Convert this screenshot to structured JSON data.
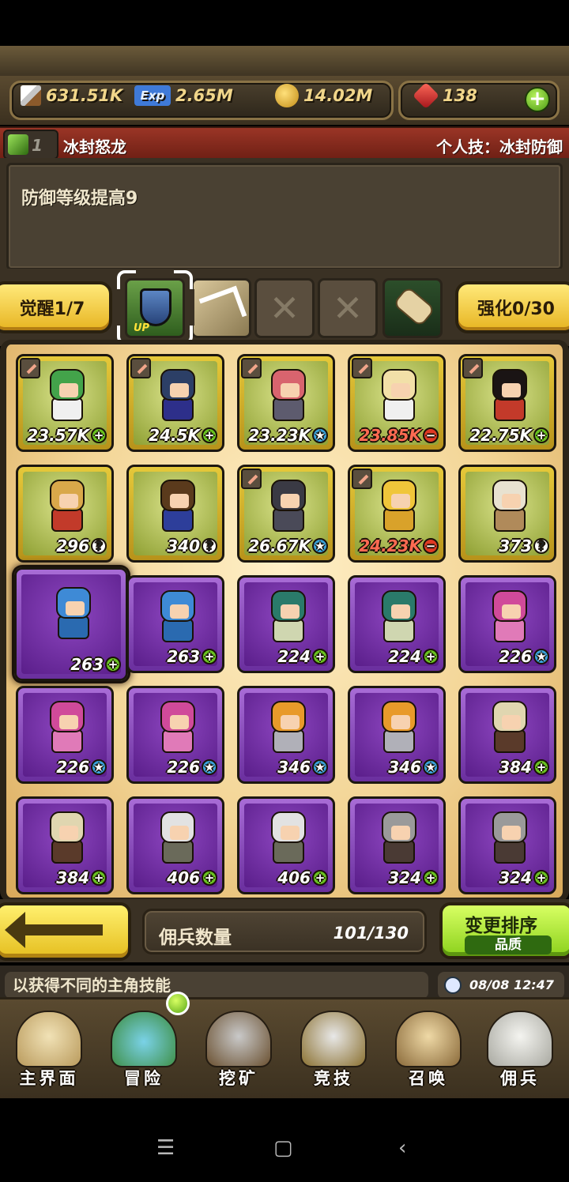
{
  "resources": {
    "attack": "631.51K",
    "exp_label": "Exp",
    "exp": "2.65M",
    "gold": "14.02M",
    "gems": "138",
    "add_label": "+"
  },
  "skill": {
    "level": "1",
    "name": "冰封怒龙",
    "personal": "个人技：冰封防御"
  },
  "description": "防御等级提高9",
  "awaken": {
    "awaken_label": "觉醒1/7",
    "enhance_label": "强化0/30",
    "slot_up": "UP",
    "slot_empty": "✕"
  },
  "roster": [
    {
      "value": "23.57K",
      "badge": "+",
      "tier": "gold",
      "weapon": true,
      "hair": "#43a34a",
      "cloth": "#f0f0f0"
    },
    {
      "value": "24.5K",
      "badge": "+",
      "tier": "gold",
      "weapon": true,
      "hair": "#2c3f66",
      "cloth": "#2d2f8a"
    },
    {
      "value": "23.23K",
      "badge": "★",
      "tier": "gold",
      "weapon": true,
      "hair": "#d8646e",
      "cloth": "#5d5b6e"
    },
    {
      "value": "23.85K",
      "badge": "−",
      "tier": "gold",
      "weapon": true,
      "hair": "#f2e0a8",
      "cloth": "#f0f0f0",
      "red": true
    },
    {
      "value": "22.75K",
      "badge": "+",
      "tier": "gold",
      "weapon": true,
      "hair": "#1a1414",
      "cloth": "#c33a2a"
    },
    {
      "value": "296",
      "badge": "?",
      "tier": "gold",
      "weapon": false,
      "hair": "#d9a84a",
      "cloth": "#c23a2a"
    },
    {
      "value": "340",
      "badge": "?",
      "tier": "gold",
      "weapon": false,
      "hair": "#5a3a1c",
      "cloth": "#2d3e9a"
    },
    {
      "value": "26.67K",
      "badge": "★",
      "tier": "gold",
      "weapon": true,
      "hair": "#3a3a44",
      "cloth": "#4a4a58"
    },
    {
      "value": "24.23K",
      "badge": "−",
      "tier": "gold",
      "weapon": true,
      "hair": "#f0c63a",
      "cloth": "#d9a22a",
      "red": true
    },
    {
      "value": "373",
      "badge": "?",
      "tier": "gold",
      "weapon": false,
      "hair": "#e8e2d0",
      "cloth": "#b08a5a"
    },
    {
      "value": "263",
      "badge": "+",
      "tier": "purple",
      "selected": true,
      "hair": "#3e8ad6",
      "cloth": "#2a6ab0"
    },
    {
      "value": "263",
      "badge": "+",
      "tier": "purple",
      "hair": "#3e8ad6",
      "cloth": "#2a6ab0"
    },
    {
      "value": "224",
      "badge": "+",
      "tier": "purple",
      "hair": "#2a7a6a",
      "cloth": "#cfd6b0"
    },
    {
      "value": "224",
      "badge": "+",
      "tier": "purple",
      "hair": "#2a7a6a",
      "cloth": "#cfd6b0"
    },
    {
      "value": "226",
      "badge": "★",
      "tier": "purple",
      "hair": "#d04a9a",
      "cloth": "#e07ab8"
    },
    {
      "value": "226",
      "badge": "★",
      "tier": "purple",
      "hair": "#d04a9a",
      "cloth": "#e07ab8"
    },
    {
      "value": "226",
      "badge": "★",
      "tier": "purple",
      "hair": "#d04a9a",
      "cloth": "#e07ab8"
    },
    {
      "value": "346",
      "badge": "★",
      "tier": "purple",
      "hair": "#e89a2a",
      "cloth": "#b0b0b8"
    },
    {
      "value": "346",
      "badge": "★",
      "tier": "purple",
      "hair": "#e89a2a",
      "cloth": "#b0b0b8"
    },
    {
      "value": "384",
      "badge": "+",
      "tier": "purple",
      "hair": "#e0d6b0",
      "cloth": "#5a3a2a"
    },
    {
      "value": "384",
      "badge": "+",
      "tier": "purple",
      "hair": "#e0d6b0",
      "cloth": "#5a3a2a"
    },
    {
      "value": "406",
      "badge": "+",
      "tier": "purple",
      "hair": "#e2e2e2",
      "cloth": "#6a6a5a"
    },
    {
      "value": "406",
      "badge": "+",
      "tier": "purple",
      "hair": "#e2e2e2",
      "cloth": "#6a6a5a"
    },
    {
      "value": "324",
      "badge": "+",
      "tier": "purple",
      "hair": "#9a9a9a",
      "cloth": "#4a3a34"
    },
    {
      "value": "324",
      "badge": "+",
      "tier": "purple",
      "hair": "#9a9a9a",
      "cloth": "#4a3a34"
    }
  ],
  "footer": {
    "mercenary_label": "佣兵数量",
    "mercenary_count": "101/130",
    "sort_label": "变更排序",
    "sort_mode": "品质"
  },
  "ticker": {
    "text": "以获得不同的主角技能",
    "time": "08/08 12:47"
  },
  "nav": [
    {
      "label": "主界面",
      "icon": "map-scroll-icon"
    },
    {
      "label": "冒险",
      "icon": "island-icon"
    },
    {
      "label": "挖矿",
      "icon": "pickaxe-icon"
    },
    {
      "label": "竞技",
      "icon": "crossed-swords-icon"
    },
    {
      "label": "召唤",
      "icon": "summon-scroll-icon"
    },
    {
      "label": "佣兵",
      "icon": "tent-icon"
    }
  ],
  "android_nav": {
    "menu": "☰",
    "home": "▢",
    "back": "‹"
  }
}
